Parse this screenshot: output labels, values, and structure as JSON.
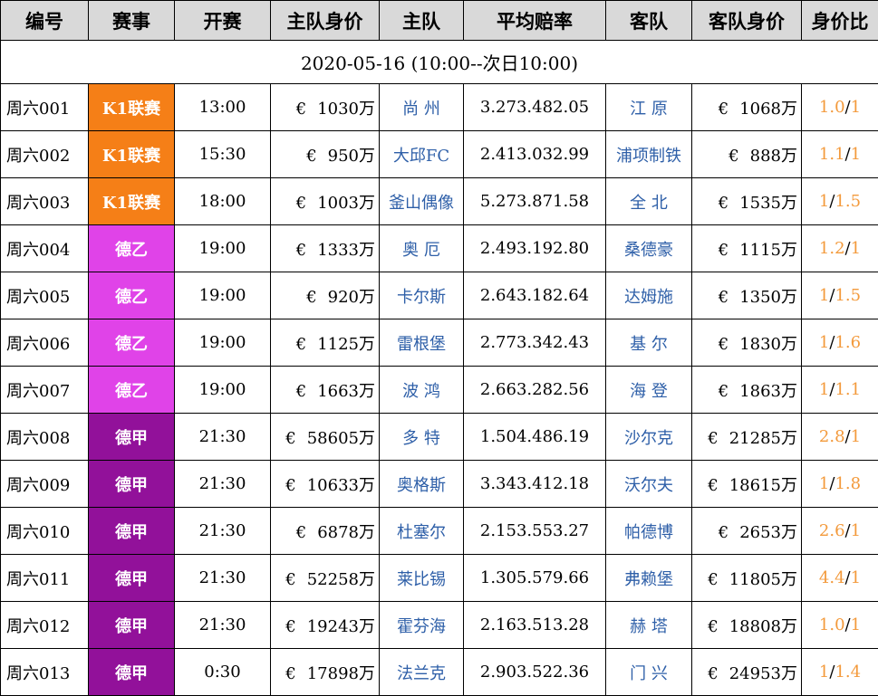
{
  "headers": [
    "编号",
    "赛事",
    "开赛",
    "主队身价",
    "主队",
    "平均赔率",
    "客队",
    "客队身价",
    "身价比"
  ],
  "date_range": "2020-05-16 (10:00--次日10:00)",
  "currency_symbol": "€",
  "colors": {
    "K1联赛": "#f57f17",
    "德乙": "#e043e8",
    "德甲": "#92119a",
    "team_text": "#2e5fa8",
    "ratio_text": "#f39a3c",
    "header_bg": "#d9d9d9"
  },
  "rows": [
    {
      "code": "周六001",
      "league": "K1联赛",
      "time": "13:00",
      "home_value": "1030万",
      "home": "尚 州",
      "odds": "3.273.482.05",
      "away": "江 原",
      "away_value": "1068万",
      "ratio_a": "1.0",
      "ratio_b": "1"
    },
    {
      "code": "周六002",
      "league": "K1联赛",
      "time": "15:30",
      "home_value": "950万",
      "home": "大邱FC",
      "odds": "2.413.032.99",
      "away": "浦项制铁",
      "away_value": "888万",
      "ratio_a": "1.1",
      "ratio_b": "1"
    },
    {
      "code": "周六003",
      "league": "K1联赛",
      "time": "18:00",
      "home_value": "1003万",
      "home": "釜山偶像",
      "odds": "5.273.871.58",
      "away": "全 北",
      "away_value": "1535万",
      "ratio_a": "1",
      "ratio_b": "1.5"
    },
    {
      "code": "周六004",
      "league": "德乙",
      "time": "19:00",
      "home_value": "1333万",
      "home": "奥 厄",
      "odds": "2.493.192.80",
      "away": "桑德豪",
      "away_value": "1115万",
      "ratio_a": "1.2",
      "ratio_b": "1"
    },
    {
      "code": "周六005",
      "league": "德乙",
      "time": "19:00",
      "home_value": "920万",
      "home": "卡尔斯",
      "odds": "2.643.182.64",
      "away": "达姆施",
      "away_value": "1350万",
      "ratio_a": "1",
      "ratio_b": "1.5"
    },
    {
      "code": "周六006",
      "league": "德乙",
      "time": "19:00",
      "home_value": "1125万",
      "home": "雷根堡",
      "odds": "2.773.342.43",
      "away": "基 尔",
      "away_value": "1830万",
      "ratio_a": "1",
      "ratio_b": "1.6"
    },
    {
      "code": "周六007",
      "league": "德乙",
      "time": "19:00",
      "home_value": "1663万",
      "home": "波 鸿",
      "odds": "2.663.282.56",
      "away": "海 登",
      "away_value": "1863万",
      "ratio_a": "1",
      "ratio_b": "1.1"
    },
    {
      "code": "周六008",
      "league": "德甲",
      "time": "21:30",
      "home_value": "58605万",
      "home": "多 特",
      "odds": "1.504.486.19",
      "away": "沙尔克",
      "away_value": "21285万",
      "ratio_a": "2.8",
      "ratio_b": "1"
    },
    {
      "code": "周六009",
      "league": "德甲",
      "time": "21:30",
      "home_value": "10633万",
      "home": "奥格斯",
      "odds": "3.343.412.18",
      "away": "沃尔夫",
      "away_value": "18615万",
      "ratio_a": "1",
      "ratio_b": "1.8"
    },
    {
      "code": "周六010",
      "league": "德甲",
      "time": "21:30",
      "home_value": "6878万",
      "home": "杜塞尔",
      "odds": "2.153.553.27",
      "away": "帕德博",
      "away_value": "2653万",
      "ratio_a": "2.6",
      "ratio_b": "1"
    },
    {
      "code": "周六011",
      "league": "德甲",
      "time": "21:30",
      "home_value": "52258万",
      "home": "莱比锡",
      "odds": "1.305.579.66",
      "away": "弗赖堡",
      "away_value": "11805万",
      "ratio_a": "4.4",
      "ratio_b": "1"
    },
    {
      "code": "周六012",
      "league": "德甲",
      "time": "21:30",
      "home_value": "19243万",
      "home": "霍芬海",
      "odds": "2.163.513.28",
      "away": "赫 塔",
      "away_value": "18808万",
      "ratio_a": "1.0",
      "ratio_b": "1"
    },
    {
      "code": "周六013",
      "league": "德甲",
      "time": "0:30",
      "home_value": "17898万",
      "home": "法兰克",
      "odds": "2.903.522.36",
      "away": "门 兴",
      "away_value": "24953万",
      "ratio_a": "1",
      "ratio_b": "1.4"
    }
  ]
}
